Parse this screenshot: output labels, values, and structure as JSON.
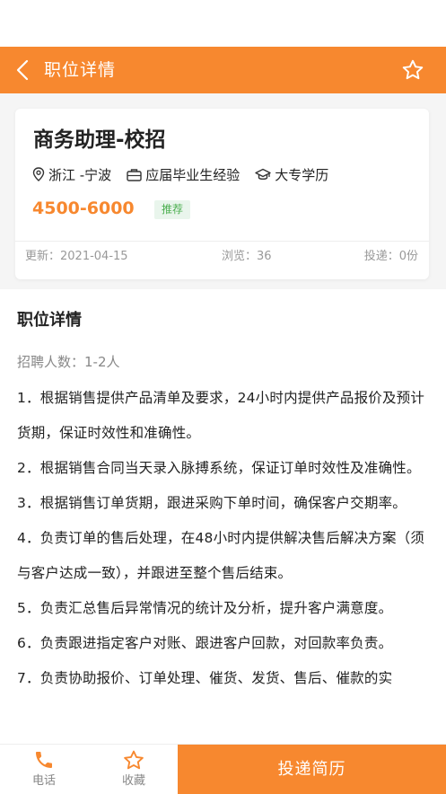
{
  "header": {
    "title": "职位详情"
  },
  "job": {
    "title": "商务助理-校招",
    "location": "浙江 -宁波",
    "experience": "应届毕业生经验",
    "education": "大专学历",
    "salary": "4500-6000",
    "tag": "推荐",
    "updated": "更新：2021-04-15",
    "views": "浏览：36",
    "applications": "投递：0份"
  },
  "details": {
    "section_title": "职位详情",
    "headcount": "招聘人数：1-2人",
    "duties": [
      "1．根据销售提供产品清单及要求，24小时内提供产品报价及预计货期，保证时效性和准确性。",
      "2．根据销售合同当天录入脉搏系统，保证订单时效性及准确性。",
      "3．根据销售订单货期，跟进采购下单时间，确保客户交期率。",
      " 4．负责订单的售后处理，在48小时内提供解决售后解决方案（须与客户达成一致），并跟进至整个售后结束。",
      " 5．负责汇总售后异常情况的统计及分析，提升客户满意度。",
      "6．负责跟进指定客户对账、跟进客户回款，对回款率负责。",
      "7．负责协助报价、订单处理、催货、发货、售后、催款的实"
    ]
  },
  "bottom_bar": {
    "call_label": "电话",
    "favorite_label": "收藏",
    "apply_label": "投递简历"
  },
  "colors": {
    "accent": "#f7882f",
    "tag_text": "#4caf50",
    "tag_bg": "#e9f5ec",
    "muted": "#999999"
  },
  "icons": {
    "back": "chevron-left-icon",
    "favorite": "star-outline-icon",
    "location": "location-pin-icon",
    "experience": "briefcase-icon",
    "education": "graduation-cap-icon",
    "call": "phone-icon"
  }
}
